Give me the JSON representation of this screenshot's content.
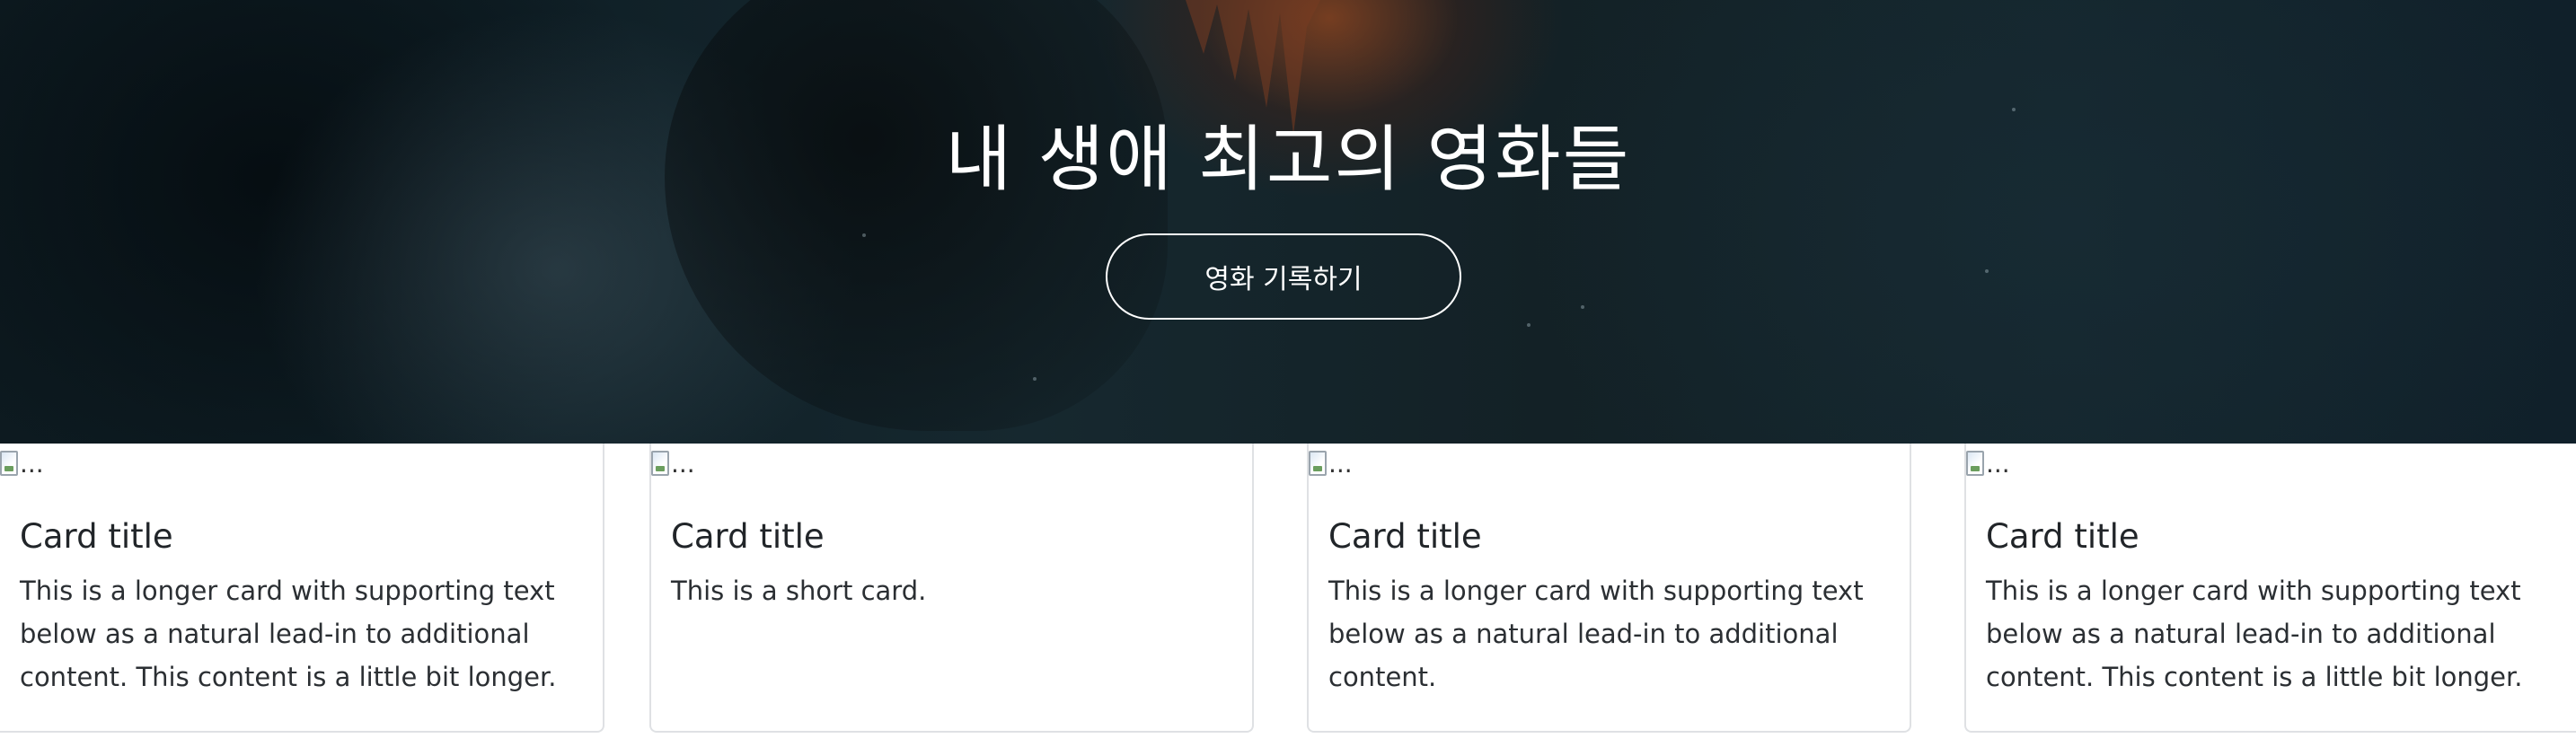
{
  "hero": {
    "title": "내 생애 최고의 영화들",
    "button_label": "영화 기록하기"
  },
  "cards": [
    {
      "image_alt": "...",
      "title": "Card title",
      "text": "This is a longer card with supporting text below as a natural lead-in to additional content. This content is a little bit longer."
    },
    {
      "image_alt": "...",
      "title": "Card title",
      "text": "This is a short card."
    },
    {
      "image_alt": "...",
      "title": "Card title",
      "text": "This is a longer card with supporting text below as a natural lead-in to additional content."
    },
    {
      "image_alt": "...",
      "title": "Card title",
      "text": "This is a longer card with supporting text below as a natural lead-in to additional content. This content is a little bit longer."
    }
  ],
  "colors": {
    "hero_background": "#13232a",
    "hero_text": "#ffffff",
    "card_border": "#dfe1e4",
    "body_text": "#212529"
  },
  "icons": {
    "card_image": "broken-image-icon"
  }
}
